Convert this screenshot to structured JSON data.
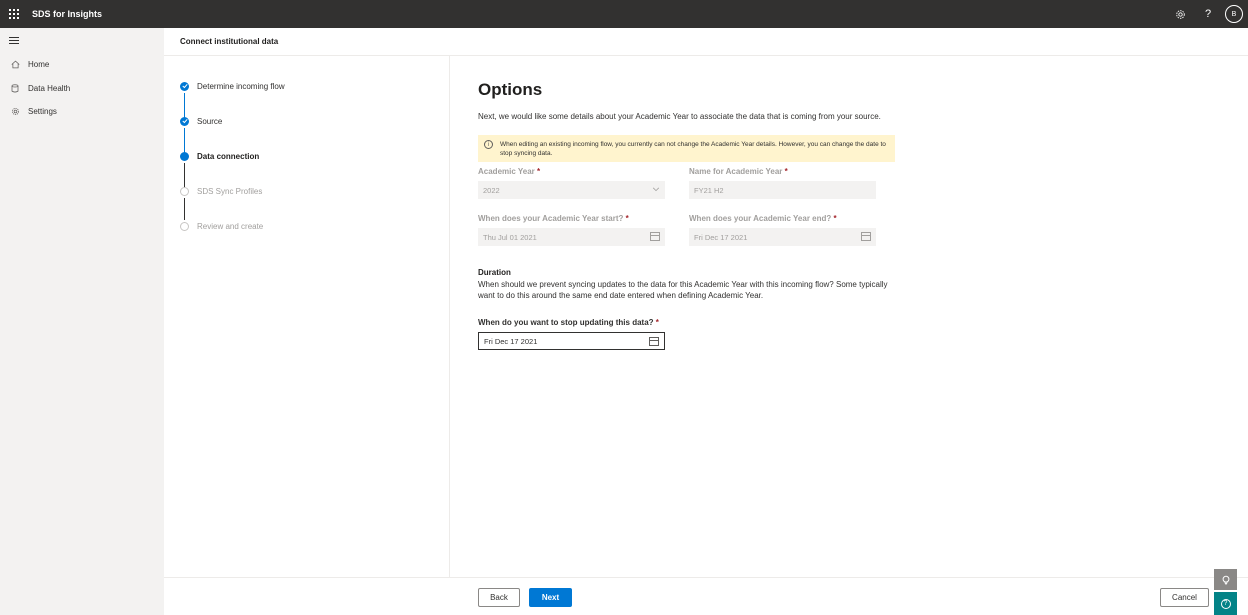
{
  "app": {
    "title": "SDS for Insights",
    "avatar_initial": "B"
  },
  "topbar_icons": [
    "settings-icon",
    "help-icon"
  ],
  "nav": {
    "items": [
      {
        "label": "Home",
        "icon": "home-icon"
      },
      {
        "label": "Data Health",
        "icon": "database-icon"
      },
      {
        "label": "Settings",
        "icon": "gear-icon"
      }
    ]
  },
  "page": {
    "title": "Connect institutional data"
  },
  "steps": [
    {
      "label": "Determine incoming flow",
      "state": "done"
    },
    {
      "label": "Source",
      "state": "done"
    },
    {
      "label": "Data connection",
      "state": "current"
    },
    {
      "label": "SDS Sync Profiles",
      "state": "future"
    },
    {
      "label": "Review and create",
      "state": "future"
    }
  ],
  "options": {
    "heading": "Options",
    "intro": "Next, we would like some details about your Academic Year to associate the data that is coming from your source.",
    "warning": "When editing an existing incoming flow, you currently can not change the Academic Year details. However, you can change the date to stop syncing data.",
    "academic_year": {
      "label": "Academic Year",
      "value": "2022"
    },
    "academic_year_name": {
      "label": "Name for Academic Year",
      "value": "FY21 H2"
    },
    "start_date": {
      "label": "When does your Academic Year start?",
      "value": "Thu Jul 01 2021"
    },
    "end_date": {
      "label": "When does your Academic Year end?",
      "value": "Fri Dec 17 2021"
    },
    "duration": {
      "title": "Duration",
      "text": "When should we prevent syncing updates to the data for this Academic Year with this incoming flow? Some typically want to do this around the same end date entered when defining Academic Year."
    },
    "stop_date": {
      "label": "When do you want to stop updating this data?",
      "value": "Fri Dec 17 2021"
    },
    "required_mark": "*"
  },
  "footer": {
    "back": "Back",
    "next": "Next",
    "cancel": "Cancel"
  },
  "colors": {
    "accent": "#0078d4",
    "topbar": "#323130",
    "warning_bg": "#fff4ce",
    "help_fab": "#038387"
  }
}
